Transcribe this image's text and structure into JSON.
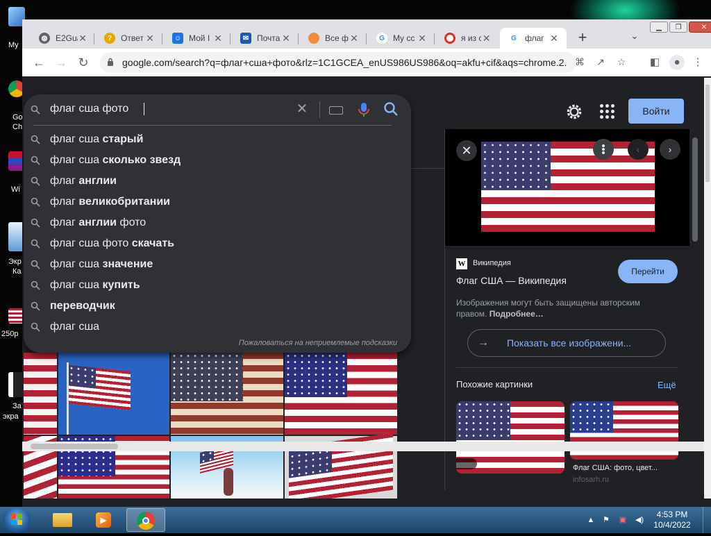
{
  "desktop": {
    "icons": [
      {
        "label": "My"
      },
      {
        "label": "Go"
      },
      {
        "label": "Ch"
      },
      {
        "label": "Wi"
      },
      {
        "label": "Экр"
      },
      {
        "label": "Ка"
      },
      {
        "label": "250р"
      },
      {
        "label": "За"
      },
      {
        "label": "экра"
      }
    ]
  },
  "browser": {
    "tabs": [
      {
        "label": "E2Gua",
        "icon": "globe-icon",
        "color": "#5f6368"
      },
      {
        "label": "Ответ",
        "icon": "question-icon",
        "color": "#e6a700"
      },
      {
        "label": "Мой I",
        "icon": "smile-icon",
        "color": "#1a73e8"
      },
      {
        "label": "Почта",
        "icon": "mail-icon",
        "color": "#1a57b5"
      },
      {
        "label": "Все ф",
        "icon": "cloud-icon",
        "color": "#f28b3c"
      },
      {
        "label": "My cc",
        "icon": "google-icon",
        "color": "#4285f4"
      },
      {
        "label": "я из с",
        "icon": "ring-icon",
        "color": "#34a853"
      },
      {
        "label": "флаг",
        "icon": "google-icon",
        "color": "#4285f4",
        "active": true
      }
    ],
    "url": "google.com/search?q=флаг+сша+фото&rlz=1C1GCEA_enUS986US986&oq=akfu+cif&aqs=chrome.2....",
    "new_tab": "+",
    "tab_search": "⌄"
  },
  "search": {
    "query": "флаг сша фото",
    "signin_label": "Войти",
    "suggestions": [
      {
        "plain": "флаг сша ",
        "bold": "старый"
      },
      {
        "plain": "флаг сша ",
        "bold": "сколько звезд"
      },
      {
        "plain": "флаг ",
        "bold": "англии"
      },
      {
        "plain": "флаг ",
        "bold": "великобритании"
      },
      {
        "plain": "флаг ",
        "bold": "англии",
        "tail": " фото"
      },
      {
        "plain": "флаг сша фото ",
        "bold": "скачать"
      },
      {
        "plain": "флаг сша ",
        "bold": "значение"
      },
      {
        "plain": "флаг сша ",
        "bold": "купить"
      },
      {
        "plain": "",
        "bold": "переводчик"
      },
      {
        "plain": "флаг сша",
        "bold": ""
      }
    ],
    "report_label": "Пожаловаться на неприемлемые подсказки"
  },
  "panel": {
    "source": "Википедия",
    "source_letter": "W",
    "title": "Флаг США — Википедия",
    "visit_label": "Перейти",
    "note": "Изображения могут быть защищены авторским правом.",
    "note_link": "Подробнее…",
    "show_all_label": "Показать все изображени...",
    "similar_label": "Похожие картинки",
    "more_label": "Ещё",
    "thumb_caption": "Флаг США: фото, цвет...",
    "thumb_source": "infosarh.ru"
  },
  "taskbar": {
    "time": "4:53 PM",
    "date": "10/4/2022"
  }
}
